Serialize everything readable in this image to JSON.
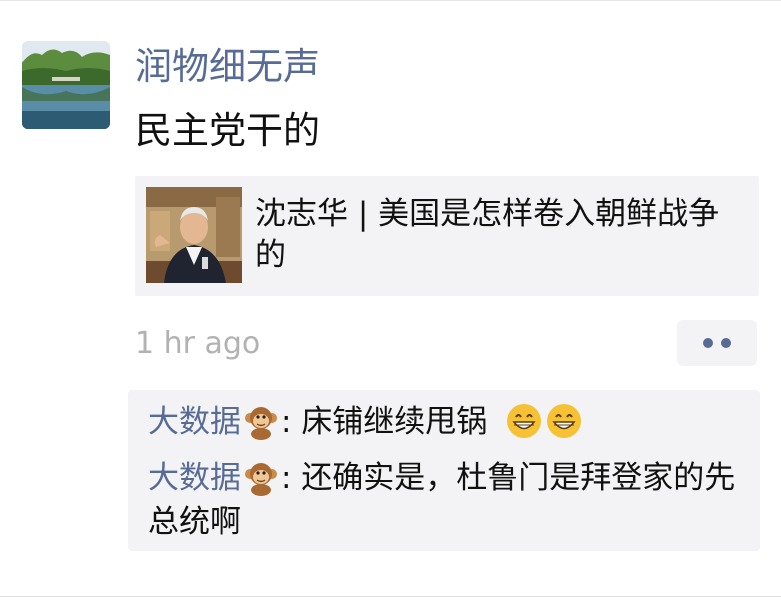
{
  "post": {
    "author": "润物细无声",
    "text": "民主党干的",
    "avatar_icon": "lake-landscape-avatar",
    "link_card": {
      "title": "沈志华 | 美国是怎样卷入朝鲜战争的",
      "thumbnail_icon": "speaker-portrait-thumbnail"
    },
    "timestamp": "1 hr ago",
    "more_icon": "more-dots-icon"
  },
  "comments": [
    {
      "user": "大数据",
      "user_emoji": "monkey-emoji",
      "separator": ":",
      "text": "床铺继续甩锅",
      "trailing_emojis": [
        "grinning-face-emoji",
        "grinning-face-emoji"
      ]
    },
    {
      "user": "大数据",
      "user_emoji": "monkey-emoji",
      "separator": ":",
      "text": "还确实是，杜鲁门是拜登家的先总统啊",
      "trailing_emojis": []
    }
  ],
  "colors": {
    "name_link": "#576b95",
    "text": "#111111",
    "timestamp": "#b2b2b2",
    "card_bg": "#f3f3f5"
  }
}
